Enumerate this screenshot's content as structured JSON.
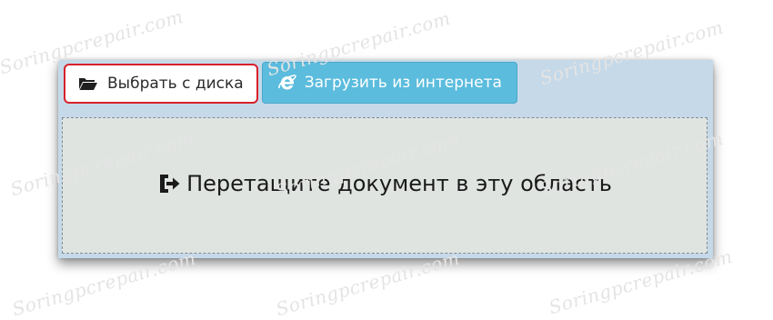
{
  "upload": {
    "tabs": {
      "from_disk_label": "Выбрать с диска",
      "from_internet_label": "Загрузить из интернета"
    },
    "dropzone": {
      "text": "Перетащите документ в эту область"
    }
  },
  "icons": {
    "disk": "folder-open-icon",
    "internet": "internet-explorer-icon",
    "drop": "sign-in-icon"
  },
  "colors": {
    "panel_bg": "#c5d9e9",
    "active_tab_bg": "#ffffff",
    "highlight_border": "#d8212a",
    "internet_tab_bg": "#5bbcdd",
    "dropzone_bg": "#e0e4e1"
  },
  "watermark": {
    "text": "Soringpcrepair.com"
  }
}
